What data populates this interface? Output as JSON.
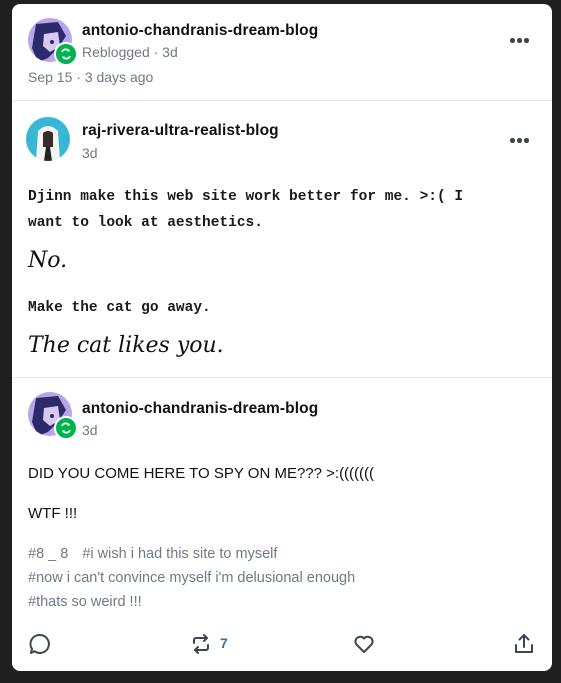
{
  "header": {
    "blogname": "antonio-chandranis-dream-blog",
    "status": "Reblogged · 3d",
    "date": "Sep 15 · 3 days ago"
  },
  "post1": {
    "blogname": "raj-rivera-ultra-realist-blog",
    "age": "3d",
    "line1": "Djinn make this web site work better for me. >:( I",
    "line2": "want to look at aesthetics.",
    "reply1": "No.",
    "line3": "Make the cat go away.",
    "reply2": "The cat likes you."
  },
  "post2": {
    "blogname": "antonio-chandranis-dream-blog",
    "age": "3d",
    "text1": "DID YOU COME HERE TO SPY ON ME??? >:(((((((",
    "text2": "WTF !!!",
    "tags": [
      "#8 _ 8",
      "#i wish i had this site to myself",
      "#now i can't convince myself i'm delusional enough",
      "#thats so weird !!!"
    ]
  },
  "footer": {
    "reblog_count": "7",
    "icons": [
      "comment-icon",
      "reblog-icon",
      "heart-icon",
      "share-icon"
    ]
  },
  "colors": {
    "reblog_green": "#00b34d",
    "secondary_text": "#6e7a86",
    "count_blue": "#3a6ea5"
  }
}
